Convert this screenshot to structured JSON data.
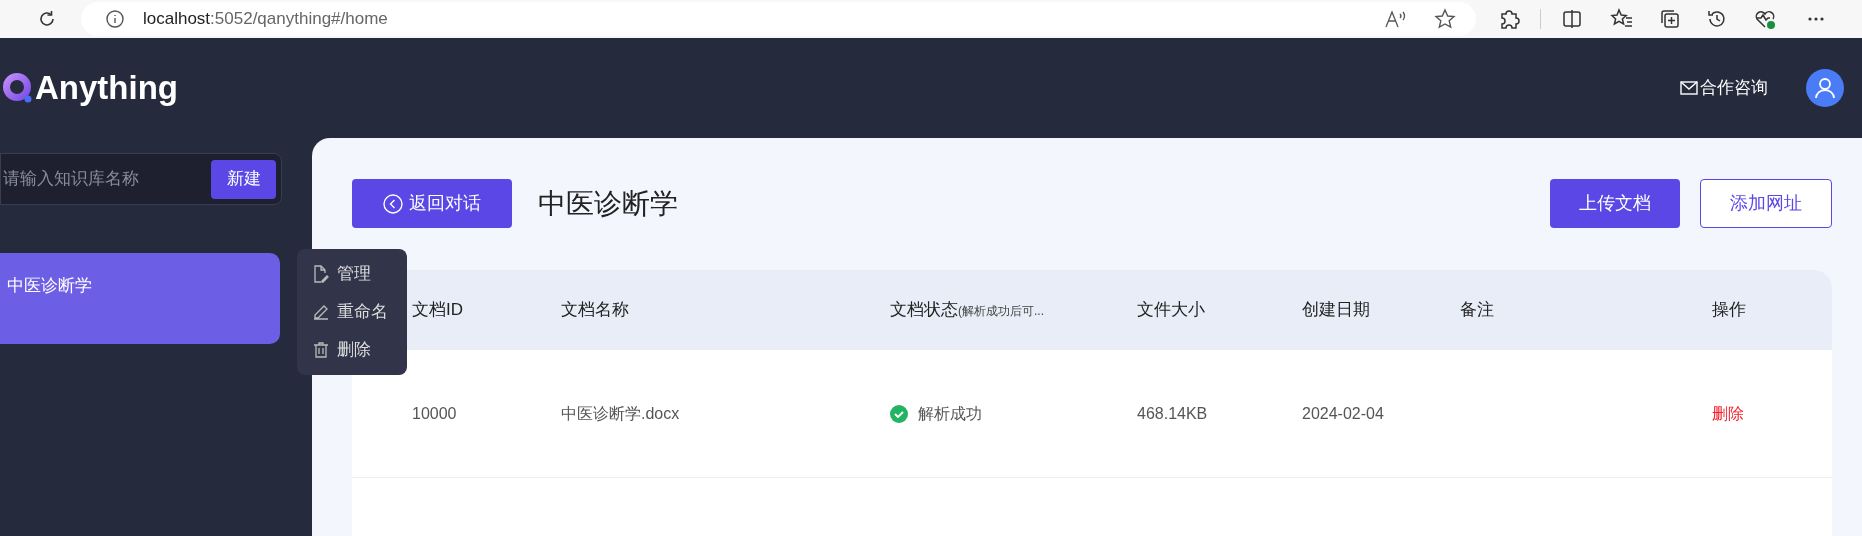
{
  "browser": {
    "url_host": "localhost",
    "url_rest": ":5052/qanything#/home"
  },
  "header": {
    "logo": "Anything",
    "contact": "合作咨询"
  },
  "sidebar": {
    "search": {
      "placeholder": "请输入知识库名称"
    },
    "new_button": "新建",
    "items": [
      {
        "name": "中医诊断学",
        "selected": true
      }
    ]
  },
  "context_menu": [
    {
      "kind": "manage",
      "label": "管理"
    },
    {
      "kind": "rename",
      "label": "重命名"
    },
    {
      "kind": "delete",
      "label": "删除"
    }
  ],
  "main": {
    "back_button": "返回对话",
    "title": "中医诊断学",
    "upload_button": "上传文档",
    "add_url_button": "添加网址"
  },
  "table": {
    "columns": [
      {
        "label": "文档ID"
      },
      {
        "label": "文档名称"
      },
      {
        "label": "文档状态",
        "note": "(解析成功后可..."
      },
      {
        "label": "文件大小"
      },
      {
        "label": "创建日期"
      },
      {
        "label": "备注"
      },
      {
        "label": "操作"
      }
    ],
    "rows": [
      {
        "id": "10000",
        "name": "中医诊断学.docx",
        "status": {
          "kind": "success",
          "text": "解析成功"
        },
        "size": "468.14KB",
        "date": "2024-02-04",
        "action": "删除"
      }
    ]
  }
}
